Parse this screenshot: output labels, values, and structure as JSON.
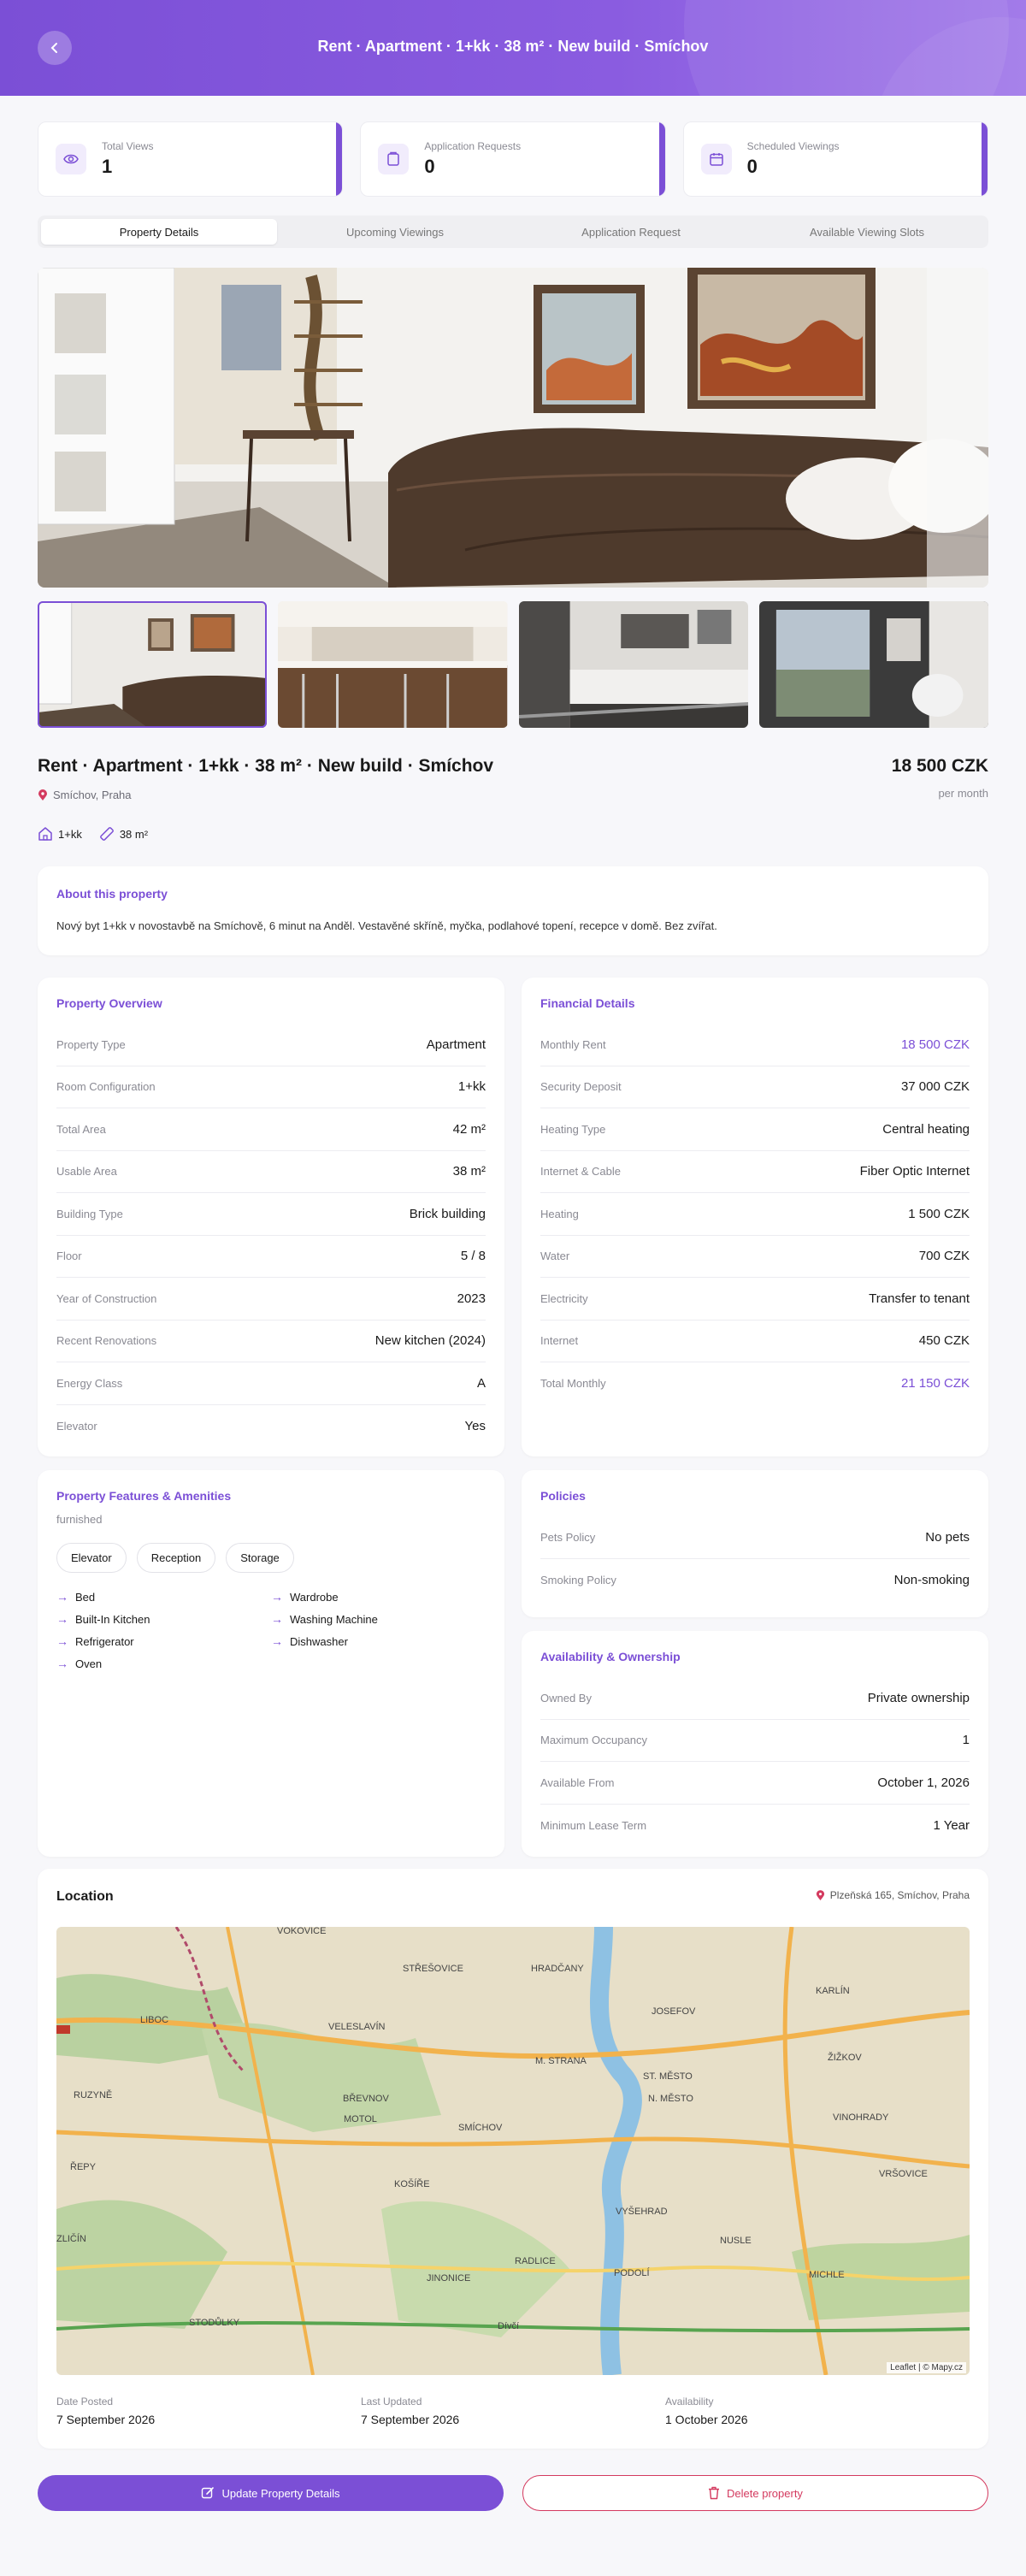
{
  "header": {
    "title": "Rent · Apartment · 1+kk · 38 m² · New build · Smíchov",
    "back_icon": "chevron-left-icon"
  },
  "stats": [
    {
      "label": "Total Views",
      "value": "1",
      "icon": "eye-icon"
    },
    {
      "label": "Application Requests",
      "value": "0",
      "icon": "document-icon"
    },
    {
      "label": "Scheduled Viewings",
      "value": "0",
      "icon": "calendar-icon"
    }
  ],
  "tabs": [
    "Property Details",
    "Upcoming Viewings",
    "Application Request",
    "Available Viewing Slots"
  ],
  "listing": {
    "title": "Rent · Apartment · 1+kk · 38 m² · New build · Smíchov",
    "location": "Smíchov, Praha",
    "price": "18 500 CZK",
    "price_period": "per month",
    "layout": "1+kk",
    "area": "38 m²"
  },
  "about": {
    "heading": "About this property",
    "text": "Nový byt 1+kk v novostavbě na Smíchově, 6 minut na Anděl. Vestavěné skříně, myčka, podlahové topení, recepce v domě. Bez zvířat."
  },
  "overview": {
    "heading": "Property Overview",
    "rows": [
      {
        "k": "Property Type",
        "v": "Apartment"
      },
      {
        "k": "Room Configuration",
        "v": "1+kk"
      },
      {
        "k": "Total Area",
        "v": "42 m²"
      },
      {
        "k": "Usable Area",
        "v": "38 m²"
      },
      {
        "k": "Building Type",
        "v": "Brick building"
      },
      {
        "k": "Floor",
        "v": "5 / 8"
      },
      {
        "k": "Year of Construction",
        "v": "2023"
      },
      {
        "k": "Recent Renovations",
        "v": "New kitchen (2024)"
      },
      {
        "k": "Energy Class",
        "v": "A"
      },
      {
        "k": "Elevator",
        "v": "Yes"
      }
    ]
  },
  "financial": {
    "heading": "Financial Details",
    "accent_color": "#7b4fd6",
    "rows": [
      {
        "k": "Monthly Rent",
        "v": "18 500 CZK"
      },
      {
        "k": "Security Deposit",
        "v": "37 000 CZK"
      },
      {
        "k": "Heating Type",
        "v": "Central heating"
      },
      {
        "k": "Internet & Cable",
        "v": "Fiber Optic Internet"
      },
      {
        "k": "Heating",
        "v": "1 500 CZK"
      },
      {
        "k": "Water",
        "v": "700 CZK"
      },
      {
        "k": "Electricity",
        "v": "Transfer to tenant"
      },
      {
        "k": "Internet",
        "v": "450 CZK"
      },
      {
        "k": "Total Monthly",
        "v": "21 150 CZK"
      }
    ]
  },
  "features": {
    "heading": "Property Features & Amenities",
    "subtitle": "furnished",
    "amenities": [
      "Elevator",
      "Reception",
      "Storage"
    ],
    "items": [
      "Bed",
      "Wardrobe",
      "Built-In Kitchen",
      "Washing Machine",
      "Refrigerator",
      "Dishwasher",
      "Oven"
    ]
  },
  "policies": {
    "heading": "Policies",
    "rows": [
      {
        "k": "Pets Policy",
        "v": "No pets"
      },
      {
        "k": "Smoking Policy",
        "v": "Non-smoking"
      }
    ]
  },
  "availability": {
    "heading": "Availability & Ownership",
    "rows": [
      {
        "k": "Owned By",
        "v": "Private ownership"
      },
      {
        "k": "Maximum Occupancy",
        "v": "1"
      },
      {
        "k": "Available From",
        "v": "October 1, 2026"
      },
      {
        "k": "Minimum Lease Term",
        "v": "1 Year"
      }
    ]
  },
  "location": {
    "title": "Location",
    "address": "Plzeňská 165, Smíchov, Praha",
    "attribution": "Leaflet | © Mapy.cz",
    "map_labels": [
      "VOKOVICE",
      "STŘEŠOVICE",
      "HRADČANY",
      "JOSEFOV",
      "KARLÍN",
      "LIBOC",
      "VELESLAVÍN",
      "M. STRANA",
      "ST. MĚSTO",
      "ŽIŽKOV",
      "RUZYNĚ",
      "BŘEVNOV",
      "N. MĚSTO",
      "VINOHRADY",
      "MOTOL",
      "SMÍCHOV",
      "ŘEPY",
      "KOŠÍŘE",
      "VRŠOVICE",
      "VYŠEHRAD",
      "ZLIČÍN",
      "NUSLE",
      "JINONICE",
      "RADLICE",
      "PODOLÍ",
      "MICHLE",
      "STODŮLKY",
      "Dívčí"
    ]
  },
  "dates": [
    {
      "k": "Date Posted",
      "v": "7 September 2026"
    },
    {
      "k": "Last Updated",
      "v": "7 September 2026"
    },
    {
      "k": "Availability",
      "v": "1 October 2026"
    }
  ],
  "actions": {
    "update": "Update Property Details",
    "delete": "Delete property"
  },
  "colors": {
    "brand": "#7b4fd6",
    "danger": "#d43a5f"
  }
}
